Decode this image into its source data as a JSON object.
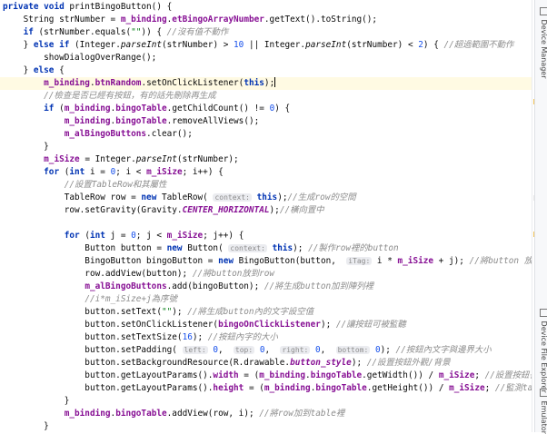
{
  "editor": {
    "lines": [
      [
        {
          "t": "private void ",
          "c": "kw"
        },
        {
          "t": "printBingoButton() {"
        }
      ],
      [
        {
          "t": "    String strNumber = "
        },
        {
          "t": "m_binding",
          "c": "field"
        },
        {
          "t": "."
        },
        {
          "t": "etBingoArrayNumber",
          "c": "field"
        },
        {
          "t": ".getText().toString();"
        }
      ],
      [
        {
          "t": "    "
        },
        {
          "t": "if",
          "c": "kw"
        },
        {
          "t": " (strNumber.equals("
        },
        {
          "t": "\"\"",
          "c": "str"
        },
        {
          "t": ")) { "
        },
        {
          "t": "//沒有值不動作",
          "c": "comment"
        }
      ],
      [
        {
          "t": "    } "
        },
        {
          "t": "else if",
          "c": "kw"
        },
        {
          "t": " (Integer."
        },
        {
          "t": "parseInt",
          "c": "ital"
        },
        {
          "t": "(strNumber) > "
        },
        {
          "t": "10",
          "c": "num"
        },
        {
          "t": " || Integer."
        },
        {
          "t": "parseInt",
          "c": "ital"
        },
        {
          "t": "(strNumber) < "
        },
        {
          "t": "2",
          "c": "num"
        },
        {
          "t": ") { "
        },
        {
          "t": "//超過範圍不動作",
          "c": "comment"
        }
      ],
      [
        {
          "t": "        showDialogOverRange();"
        }
      ],
      [
        {
          "t": "    } "
        },
        {
          "t": "else",
          "c": "kw"
        },
        {
          "t": " {"
        }
      ],
      [
        {
          "t": "        "
        },
        {
          "t": "m_binding",
          "c": "field"
        },
        {
          "t": "."
        },
        {
          "t": "btnRandom",
          "c": "field"
        },
        {
          "t": ".setOnClickListener("
        },
        {
          "t": "this",
          "c": "kw"
        },
        {
          "t": ")"
        },
        {
          "t": ";",
          "c": "caret"
        }
      ],
      [
        {
          "t": "        "
        },
        {
          "t": "//檢查是否已經有按鈕，有的話先刪除再生成",
          "c": "comment"
        }
      ],
      [
        {
          "t": "        "
        },
        {
          "t": "if",
          "c": "kw"
        },
        {
          "t": " ("
        },
        {
          "t": "m_binding",
          "c": "field"
        },
        {
          "t": "."
        },
        {
          "t": "bingoTable",
          "c": "field"
        },
        {
          "t": ".getChildCount() != "
        },
        {
          "t": "0",
          "c": "num"
        },
        {
          "t": ") {"
        }
      ],
      [
        {
          "t": "            "
        },
        {
          "t": "m_binding",
          "c": "field"
        },
        {
          "t": "."
        },
        {
          "t": "bingoTable",
          "c": "field"
        },
        {
          "t": ".removeAllViews();"
        }
      ],
      [
        {
          "t": "            "
        },
        {
          "t": "m_alBingoButtons",
          "c": "field"
        },
        {
          "t": ".clear();"
        }
      ],
      [
        {
          "t": "        }"
        }
      ],
      [
        {
          "t": "        "
        },
        {
          "t": "m_iSize",
          "c": "field"
        },
        {
          "t": " = Integer."
        },
        {
          "t": "parseInt",
          "c": "ital"
        },
        {
          "t": "(strNumber);"
        }
      ],
      [
        {
          "t": "        "
        },
        {
          "t": "for",
          "c": "kw"
        },
        {
          "t": " ("
        },
        {
          "t": "int",
          "c": "kw"
        },
        {
          "t": " i = "
        },
        {
          "t": "0",
          "c": "num"
        },
        {
          "t": "; i < "
        },
        {
          "t": "m_iSize",
          "c": "field"
        },
        {
          "t": "; i++) {"
        }
      ],
      [
        {
          "t": "            "
        },
        {
          "t": "//設置TableRow和其屬性",
          "c": "comment"
        }
      ],
      [
        {
          "t": "            TableRow row = "
        },
        {
          "t": "new",
          "c": "kw"
        },
        {
          "t": " TableRow( "
        },
        {
          "t": "context:",
          "c": "hint"
        },
        {
          "t": " "
        },
        {
          "t": "this",
          "c": "kw"
        },
        {
          "t": ");"
        },
        {
          "t": "//生成row的空間",
          "c": "comment"
        }
      ],
      [
        {
          "t": "            row.setGravity(Gravity."
        },
        {
          "t": "CENTER_HORIZONTAL",
          "c": "const"
        },
        {
          "t": ");"
        },
        {
          "t": "//橫向置中",
          "c": "comment"
        }
      ],
      [],
      [
        {
          "t": "            "
        },
        {
          "t": "for",
          "c": "kw"
        },
        {
          "t": " ("
        },
        {
          "t": "int",
          "c": "kw"
        },
        {
          "t": " j = "
        },
        {
          "t": "0",
          "c": "num"
        },
        {
          "t": "; j < "
        },
        {
          "t": "m_iSize",
          "c": "field"
        },
        {
          "t": "; j++) {"
        }
      ],
      [
        {
          "t": "                Button button = "
        },
        {
          "t": "new",
          "c": "kw"
        },
        {
          "t": " Button( "
        },
        {
          "t": "context:",
          "c": "hint"
        },
        {
          "t": " "
        },
        {
          "t": "this",
          "c": "kw"
        },
        {
          "t": "); "
        },
        {
          "t": "//製作row裡的button",
          "c": "comment"
        }
      ],
      [
        {
          "t": "                BingoButton bingoButton = "
        },
        {
          "t": "new",
          "c": "kw"
        },
        {
          "t": " BingoButton(button,  "
        },
        {
          "t": "iTag:",
          "c": "hint"
        },
        {
          "t": " i * "
        },
        {
          "t": "m_iSize",
          "c": "field"
        },
        {
          "t": " + j); "
        },
        {
          "t": "//將button 放進bingobutton類別",
          "c": "comment"
        }
      ],
      [
        {
          "t": "                row.addView(button); "
        },
        {
          "t": "//將button放到row",
          "c": "comment"
        }
      ],
      [
        {
          "t": "                "
        },
        {
          "t": "m_alBingoButtons",
          "c": "field"
        },
        {
          "t": ".add(bingoButton); "
        },
        {
          "t": "//將生成button加到陣列裡",
          "c": "comment"
        }
      ],
      [
        {
          "t": "                "
        },
        {
          "t": "//i*m_iSize+j為序號",
          "c": "comment"
        }
      ],
      [
        {
          "t": "                button.setText("
        },
        {
          "t": "\"\"",
          "c": "str"
        },
        {
          "t": "); "
        },
        {
          "t": "//將生成button內的文字設空值",
          "c": "comment"
        }
      ],
      [
        {
          "t": "                button.setOnClickListener("
        },
        {
          "t": "bingoOnClickListener",
          "c": "field"
        },
        {
          "t": "); "
        },
        {
          "t": "//讓按鈕可被監聽",
          "c": "comment"
        }
      ],
      [
        {
          "t": "                button.setTextSize("
        },
        {
          "t": "16",
          "c": "num"
        },
        {
          "t": "); "
        },
        {
          "t": "//按鈕內字的大小",
          "c": "comment"
        }
      ],
      [
        {
          "t": "                button.setPadding( "
        },
        {
          "t": "left:",
          "c": "hint"
        },
        {
          "t": " "
        },
        {
          "t": "0",
          "c": "num"
        },
        {
          "t": ",  "
        },
        {
          "t": "top:",
          "c": "hint"
        },
        {
          "t": " "
        },
        {
          "t": "0",
          "c": "num"
        },
        {
          "t": ",  "
        },
        {
          "t": "right:",
          "c": "hint"
        },
        {
          "t": " "
        },
        {
          "t": "0",
          "c": "num"
        },
        {
          "t": ",  "
        },
        {
          "t": "bottom:",
          "c": "hint"
        },
        {
          "t": " "
        },
        {
          "t": "0",
          "c": "num"
        },
        {
          "t": "); "
        },
        {
          "t": "//按鈕內文字與邊界大小",
          "c": "comment"
        }
      ],
      [
        {
          "t": "                button.setBackgroundResource(R.drawable."
        },
        {
          "t": "button_style",
          "c": "const"
        },
        {
          "t": "); "
        },
        {
          "t": "//設置按鈕外觀/背景",
          "c": "comment"
        }
      ],
      [
        {
          "t": "                button.getLayoutParams()."
        },
        {
          "t": "width",
          "c": "field"
        },
        {
          "t": " = ("
        },
        {
          "t": "m_binding",
          "c": "field"
        },
        {
          "t": "."
        },
        {
          "t": "bingoTable",
          "c": "field"
        },
        {
          "t": ".getWidth()) / "
        },
        {
          "t": "m_iSize",
          "c": "field"
        },
        {
          "t": "; "
        },
        {
          "t": "//設置按鈕長寬",
          "c": "comment"
        }
      ],
      [
        {
          "t": "                button.getLayoutParams()."
        },
        {
          "t": "height",
          "c": "field"
        },
        {
          "t": " = ("
        },
        {
          "t": "m_binding",
          "c": "field"
        },
        {
          "t": "."
        },
        {
          "t": "bingoTable",
          "c": "field"
        },
        {
          "t": ".getHeight()) / "
        },
        {
          "t": "m_iSize",
          "c": "field"
        },
        {
          "t": "; "
        },
        {
          "t": "//監測table大小後，依table",
          "c": "comment"
        }
      ],
      [
        {
          "t": "            }"
        }
      ],
      [
        {
          "t": "            "
        },
        {
          "t": "m_binding",
          "c": "field"
        },
        {
          "t": "."
        },
        {
          "t": "bingoTable",
          "c": "field"
        },
        {
          "t": ".addView(row, i); "
        },
        {
          "t": "//將row加到table裡",
          "c": "comment"
        }
      ],
      [
        {
          "t": "        }"
        }
      ]
    ],
    "highlighted_line": 6
  },
  "right_rail": {
    "tabs": [
      {
        "label": "Device Manager",
        "icon": "device-manager-icon"
      },
      {
        "label": "Device File Explorer",
        "icon": "device-file-explorer-icon"
      },
      {
        "label": "Emulator",
        "icon": "emulator-icon"
      }
    ]
  },
  "colors": {
    "keyword": "#0033b3",
    "field": "#871094",
    "comment": "#8c8c8c",
    "number": "#1750eb",
    "string": "#067d17",
    "highlight": "#fffae3",
    "marker_warning": "#f2c55c",
    "marker_info": "#e8e8e8"
  }
}
